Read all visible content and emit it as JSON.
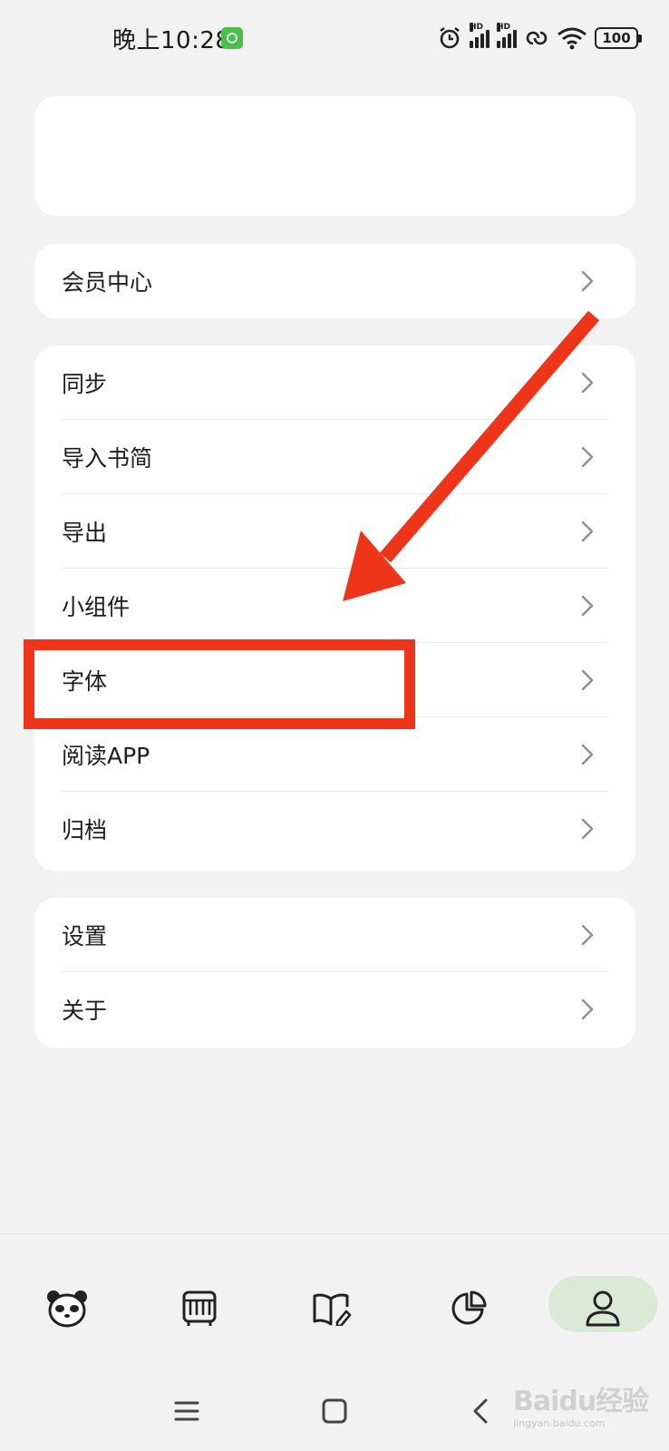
{
  "status_bar": {
    "time": "晚上10:28",
    "hd_label": "HD",
    "battery": "100"
  },
  "vip_row": {
    "label": "会员中心"
  },
  "menu": {
    "items": [
      {
        "label": "同步"
      },
      {
        "label": "导入书简"
      },
      {
        "label": "导出"
      },
      {
        "label": "小组件"
      },
      {
        "label": "字体"
      },
      {
        "label": "阅读APP"
      },
      {
        "label": "归档"
      }
    ]
  },
  "settings_group": {
    "items": [
      {
        "label": "设置"
      },
      {
        "label": "关于"
      }
    ]
  },
  "tabbar": {
    "tabs": [
      {
        "icon": "panda-icon"
      },
      {
        "icon": "bookshelf-icon"
      },
      {
        "icon": "book-edit-icon"
      },
      {
        "icon": "pie-chart-icon"
      },
      {
        "icon": "person-icon",
        "active": true
      }
    ]
  },
  "watermark": {
    "text": "Baidu经验",
    "sub": "jingyan.baidu.com"
  },
  "colors": {
    "annotation": "#ee3419",
    "active_tab_bg": "#dbe9d7",
    "background": "#f1f2f1"
  }
}
